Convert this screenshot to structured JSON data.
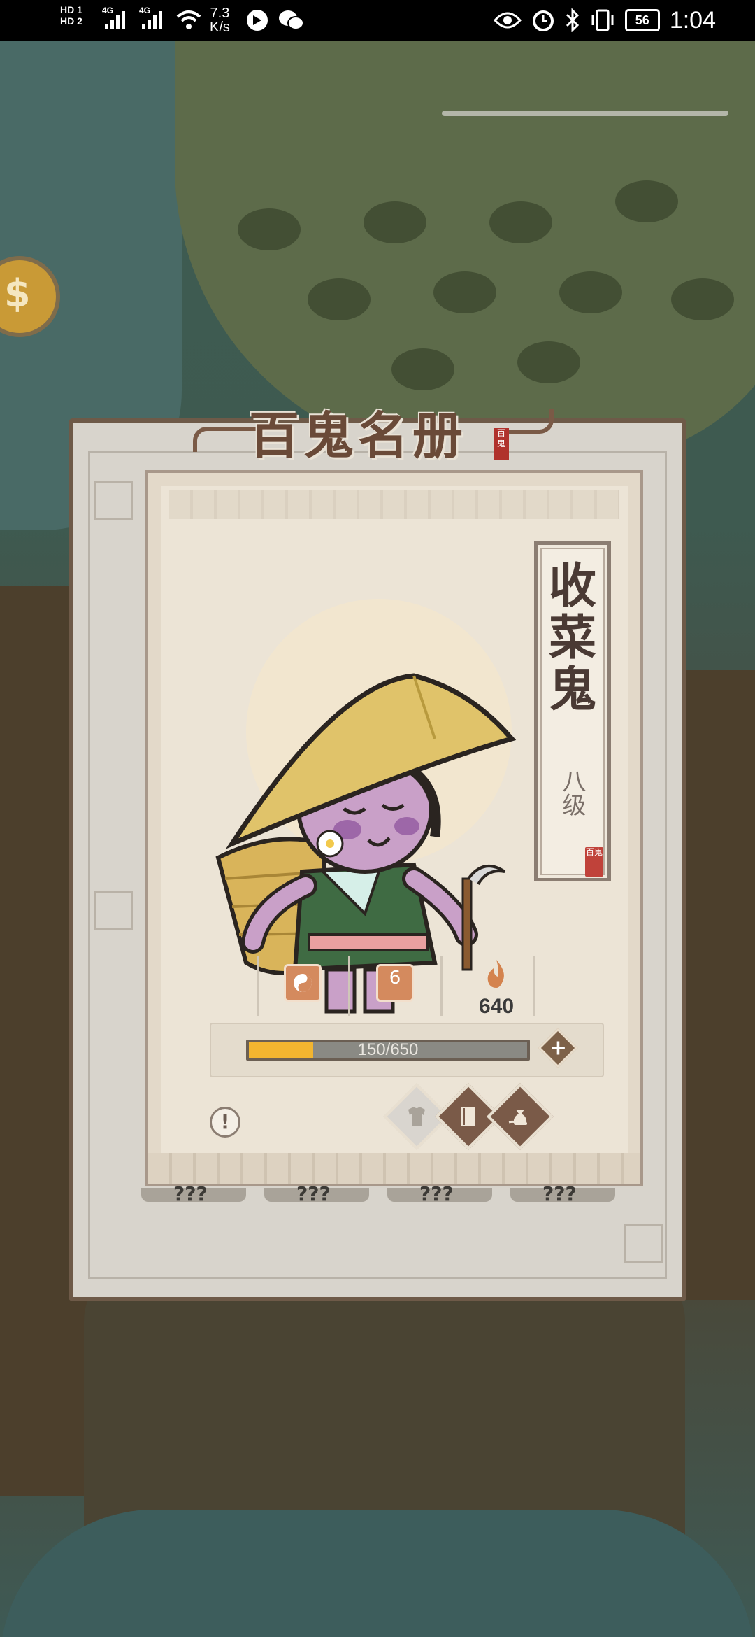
{
  "status_bar": {
    "hd1": "HD 1",
    "hd2": "HD 2",
    "net1": "4G",
    "net2": "4G",
    "speed_value": "7.3",
    "speed_unit": "K/s",
    "battery": "56",
    "time": "1:04"
  },
  "panel": {
    "title": "百鬼名册",
    "seal_text": "百鬼"
  },
  "card": {
    "name": "收菜鬼",
    "level": "八级",
    "seal_text": "百鬼",
    "stats": {
      "badge_number": "6",
      "fire_value": "640"
    },
    "progress": {
      "current": 150,
      "max": 650,
      "label": "150/650"
    },
    "actions": {
      "info_icon": "!",
      "plus_icon": "+",
      "buttons": [
        "clothes-icon",
        "book-icon",
        "bag-icon"
      ]
    }
  },
  "underneath_cards": [
    "???",
    "???",
    "???",
    "???"
  ]
}
